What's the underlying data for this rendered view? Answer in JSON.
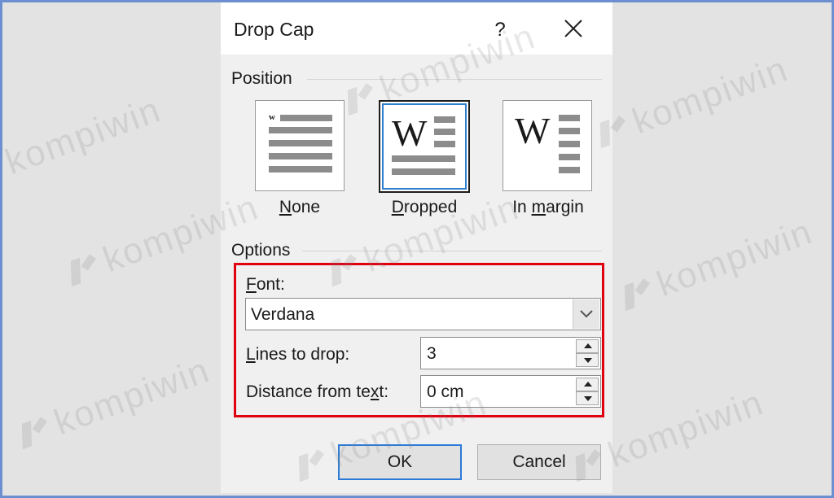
{
  "dialog": {
    "title": "Drop Cap",
    "help_label": "?"
  },
  "position": {
    "group_label": "Position",
    "options": [
      {
        "pre": "",
        "u": "N",
        "post": "one",
        "icon": "w",
        "selected": false
      },
      {
        "pre": "",
        "u": "D",
        "post": "ropped",
        "icon": "W",
        "selected": true
      },
      {
        "pre": "In ",
        "u": "m",
        "post": "argin",
        "icon": "W",
        "selected": false
      }
    ]
  },
  "options": {
    "group_label": "Options",
    "font": {
      "pre": "",
      "u": "F",
      "post": "ont:",
      "value": "Verdana"
    },
    "lines": {
      "pre": "",
      "u": "L",
      "post": "ines to drop:",
      "value": "3"
    },
    "distance": {
      "pre": "Distance from te",
      "u": "x",
      "post": "t:",
      "value": "0 cm"
    }
  },
  "buttons": {
    "ok": "OK",
    "cancel": "Cancel"
  },
  "watermark": {
    "text": "kompiwin"
  },
  "colors": {
    "highlight": "#e00010",
    "focus": "#2b7bd6",
    "frame": "#6c8fd0"
  }
}
